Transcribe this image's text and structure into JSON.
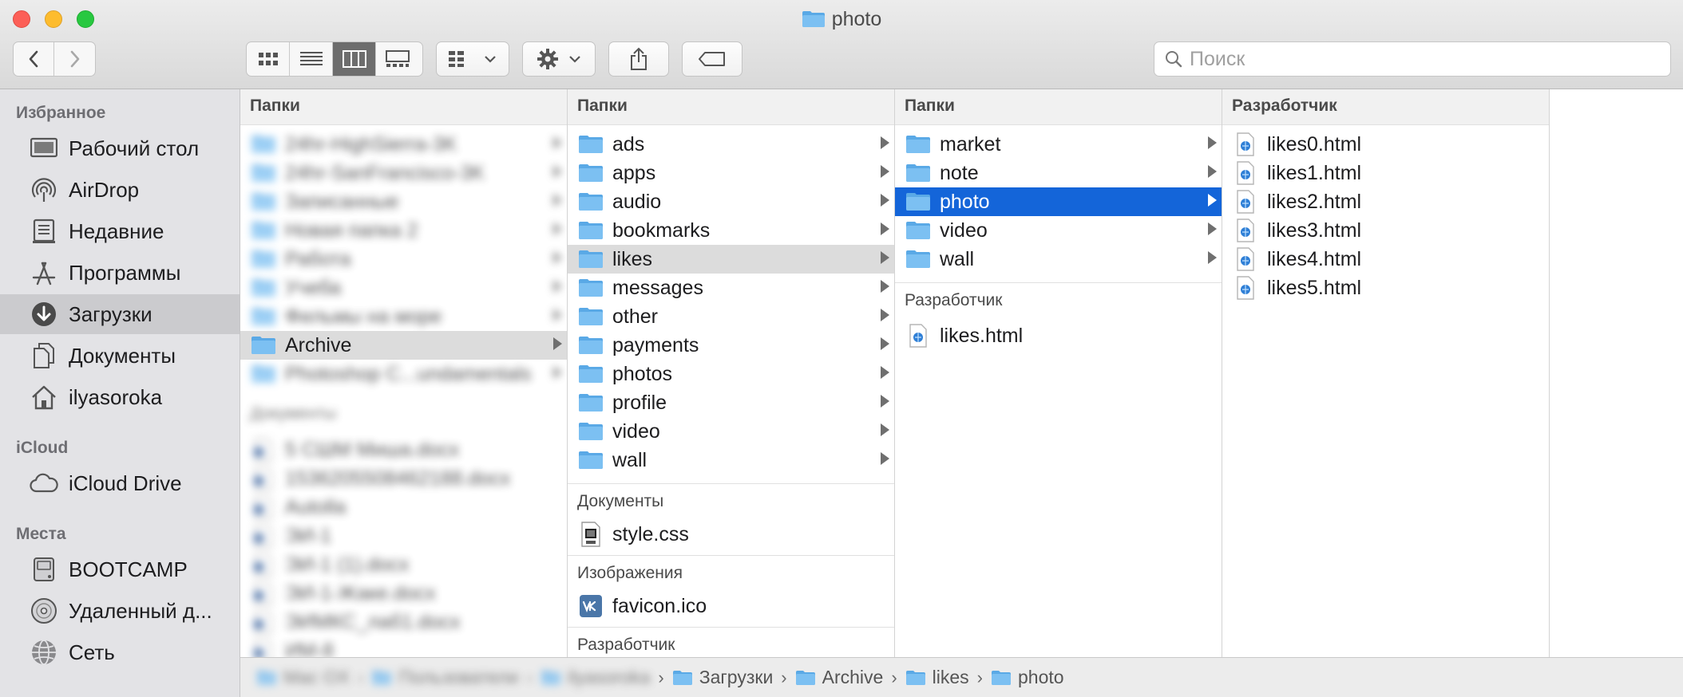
{
  "window": {
    "title": "photo",
    "colors": {
      "selection_blue": "#1465d9",
      "folder_blue": "#5aa9e6",
      "sidebar_bg": "#e3e3e6"
    }
  },
  "toolbar": {
    "back_icon": "chevron-left-icon",
    "forward_icon": "chevron-right-icon",
    "view_modes": [
      "icon-view",
      "list-view",
      "column-view",
      "gallery-view"
    ],
    "active_view": "column-view",
    "group_icon": "group-grid-icon",
    "action_icon": "gear-icon",
    "share_icon": "share-icon",
    "tag_icon": "tag-icon",
    "search_placeholder": "Поиск"
  },
  "sidebar": {
    "favorites_header": "Избранное",
    "favorites": [
      {
        "label": "Рабочий стол",
        "icon": "desktop-icon"
      },
      {
        "label": "AirDrop",
        "icon": "airdrop-icon"
      },
      {
        "label": "Недавние",
        "icon": "recents-icon"
      },
      {
        "label": "Программы",
        "icon": "applications-icon"
      },
      {
        "label": "Загрузки",
        "icon": "downloads-icon",
        "selected": true
      },
      {
        "label": "Документы",
        "icon": "documents-icon"
      },
      {
        "label": "ilyasoroka",
        "icon": "home-icon"
      }
    ],
    "icloud_header": "iCloud",
    "icloud": [
      {
        "label": "iCloud Drive",
        "icon": "cloud-icon"
      }
    ],
    "places_header": "Места",
    "places": [
      {
        "label": "BOOTCAMP",
        "icon": "disk-icon"
      },
      {
        "label": "Удаленный д...",
        "icon": "remote-disc-icon"
      },
      {
        "label": "Сеть",
        "icon": "network-icon"
      }
    ]
  },
  "columns": {
    "col1": {
      "folders_header": "Папки",
      "folders": [
        "24hr-HighSierra-3K",
        "24hr-SanFrancisco-3K",
        "Записанные",
        "Новая папка 2",
        "Работа",
        "Учеба",
        "Фильмы на море",
        "Archive",
        "Photoshop C...undamentals"
      ],
      "selected_folder": "Archive",
      "docs_header": "Документы",
      "docs": [
        "5 СШМ Миша.docx",
        "1536205508462188.docx",
        "Autolla",
        "ЭИ-1",
        "ЭИ-1 (1).docx",
        "ЭИ-1-Жаке.docx",
        "ЭИМКС_лаб1.docx",
        "ИМ-8"
      ]
    },
    "col2": {
      "folders_header": "Папки",
      "folders": [
        "ads",
        "apps",
        "audio",
        "bookmarks",
        "likes",
        "messages",
        "other",
        "payments",
        "photos",
        "profile",
        "video",
        "wall"
      ],
      "selected_folder": "likes",
      "docs_header": "Документы",
      "docs": [
        "style.css"
      ],
      "images_header": "Изображения",
      "images": [
        "favicon.ico"
      ],
      "dev_header": "Разработчик"
    },
    "col3": {
      "folders_header": "Папки",
      "folders": [
        "market",
        "note",
        "photo",
        "video",
        "wall"
      ],
      "selected_folder": "photo",
      "dev_header": "Разработчик",
      "dev_files": [
        "likes.html"
      ]
    },
    "col4": {
      "dev_header": "Разработчик",
      "dev_files": [
        "likes0.html",
        "likes1.html",
        "likes2.html",
        "likes3.html",
        "likes4.html",
        "likes5.html"
      ]
    }
  },
  "pathbar": {
    "crumbs": [
      {
        "label": "Mac OX",
        "icon": "disk-icon",
        "blurred": true
      },
      {
        "label": "Пользователи",
        "icon": "folder-icon",
        "blurred": true
      },
      {
        "label": "ilyasoroka",
        "icon": "home-icon",
        "blurred": true
      },
      {
        "label": "Загрузки",
        "icon": "downloads-folder-icon",
        "blurred": false
      },
      {
        "label": "Archive",
        "icon": "folder-icon",
        "blurred": false
      },
      {
        "label": "likes",
        "icon": "folder-icon",
        "blurred": false
      },
      {
        "label": "photo",
        "icon": "folder-icon",
        "blurred": false
      }
    ]
  }
}
